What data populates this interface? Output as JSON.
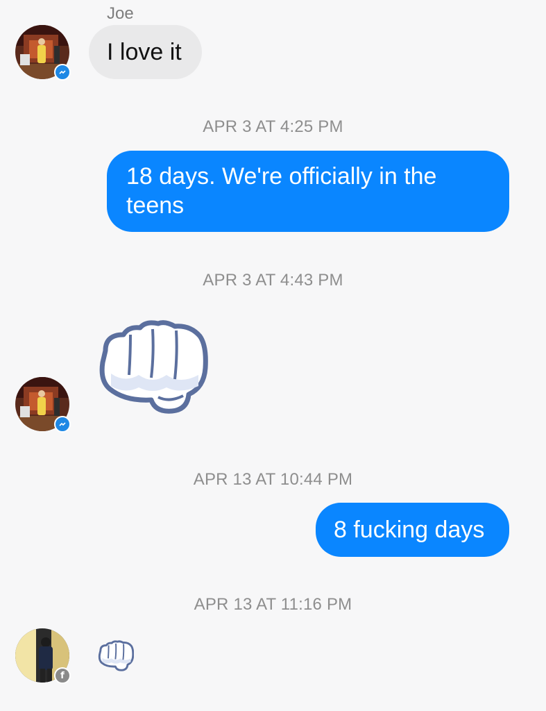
{
  "conversation": {
    "sender_name": "Joe",
    "messages": [
      {
        "type": "incoming_text",
        "text": "I love it"
      },
      {
        "type": "timestamp",
        "text": "APR 3 AT 4:25 PM"
      },
      {
        "type": "outgoing_text",
        "text": "18 days. We're officially in the teens"
      },
      {
        "type": "timestamp",
        "text": "APR 3 AT 4:43 PM"
      },
      {
        "type": "incoming_sticker",
        "sticker": "fist-bump-sticker"
      },
      {
        "type": "timestamp",
        "text": "APR 13 AT 10:44 PM"
      },
      {
        "type": "outgoing_text",
        "text": "8 fucking days"
      },
      {
        "type": "timestamp",
        "text": "APR 13 AT 11:16 PM"
      },
      {
        "type": "incoming_sticker",
        "sticker": "fist-bump-sticker-small"
      }
    ]
  },
  "colors": {
    "outgoing_bubble": "#0a86ff",
    "incoming_bubble": "#e9e9ea",
    "background": "#f7f7f8",
    "messenger_badge": "#1e88e5",
    "facebook_badge": "#8a8a8a"
  },
  "icons": {
    "messenger_badge": "messenger-icon",
    "facebook_badge": "facebook-icon"
  }
}
